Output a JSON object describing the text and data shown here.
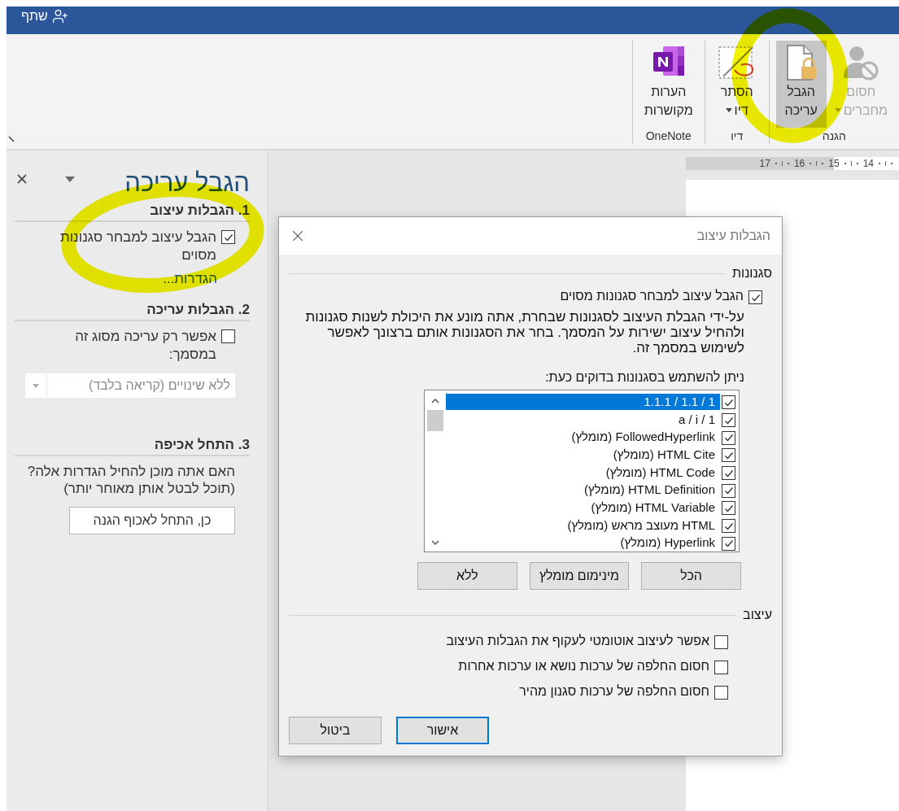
{
  "title_bar": {
    "share": "שתף"
  },
  "ribbon": {
    "groups": [
      {
        "label": "הגנה",
        "buttons": [
          {
            "kind": "block-authors",
            "lines": [
              "חסום",
              "מחברים"
            ],
            "dropdown": true,
            "disabled": true,
            "selected": false
          },
          {
            "kind": "restrict-editing",
            "lines": [
              "הגבל",
              "עריכה"
            ],
            "dropdown": false,
            "disabled": false,
            "selected": true
          }
        ]
      },
      {
        "label": "דיו",
        "buttons": [
          {
            "kind": "hide-ink",
            "lines": [
              "הסתר",
              "דיו"
            ],
            "dropdown": true,
            "disabled": false,
            "selected": false
          }
        ]
      },
      {
        "label": "OneNote",
        "buttons": [
          {
            "kind": "onenote",
            "lines": [
              "הערות",
              "מקושרות"
            ],
            "dropdown": false,
            "disabled": false,
            "selected": false
          }
        ]
      }
    ]
  },
  "ruler": {
    "labels": [
      "14",
      "15",
      "16",
      "17"
    ]
  },
  "pane": {
    "title": "הגבל עריכה",
    "sections": [
      {
        "heading": "1. הגבלות עיצוב",
        "items": [
          {
            "kind": "checkbox",
            "label": "הגבל עיצוב למבחר סגנונות מסוים",
            "checked": true
          },
          {
            "kind": "link",
            "label": "הגדרות..."
          }
        ]
      },
      {
        "heading": "2. הגבלות עריכה",
        "items": [
          {
            "kind": "checkbox",
            "label": "אפשר רק עריכה מסוג זה במסמך:",
            "checked": false
          },
          {
            "kind": "dropdown",
            "value": "ללא שינויים (קריאה בלבד)",
            "disabled": true
          }
        ]
      },
      {
        "heading": "3. התחל אכיפה",
        "items": [
          {
            "kind": "text",
            "text": "האם אתה מוכן להחיל הגדרות אלה? (תוכל לבטל אותן מאוחר יותר)"
          },
          {
            "kind": "button",
            "label": "כן, התחל לאכוף הגנה"
          }
        ]
      }
    ]
  },
  "dialog": {
    "title": "הגבלות עיצוב",
    "styles": {
      "heading": "סגנונות",
      "limit": {
        "label": "הגבל עיצוב למבחר סגנונות מסוים",
        "checked": true
      },
      "description": "על-ידי הגבלת העיצוב לסגנונות שבחרת, אתה מונע את היכולת לשנות סגנונות ולהחיל עיצוב ישירות על המסמך. בחר את הסגנונות אותם ברצונך לאפשר לשימוש במסמך זה.",
      "list_label": "ניתן להשתמש בסגנונות בדוקים כעת:",
      "list": [
        {
          "label": "1 / 1.1 / 1.1.1",
          "checked": true,
          "selected": true
        },
        {
          "label": "1 / a / i",
          "checked": true,
          "selected": false
        },
        {
          "label": "FollowedHyperlink (מומלץ)",
          "checked": true,
          "selected": false
        },
        {
          "label": "HTML Cite (מומלץ)",
          "checked": true,
          "selected": false
        },
        {
          "label": "HTML Code (מומלץ)",
          "checked": true,
          "selected": false
        },
        {
          "label": "HTML Definition (מומלץ)",
          "checked": true,
          "selected": false
        },
        {
          "label": "HTML Variable (מומלץ)",
          "checked": true,
          "selected": false
        },
        {
          "label": "HTML מעוצב מראש (מומלץ)",
          "checked": true,
          "selected": false
        },
        {
          "label": "Hyperlink (מומלץ)",
          "checked": true,
          "selected": false
        }
      ],
      "buttons": [
        "הכל",
        "מינימום מומלץ",
        "ללא"
      ]
    },
    "formatting": {
      "heading": "עיצוב",
      "options": [
        {
          "label": "אפשר לעיצוב אוטומטי לעקוף את הגבלות העיצוב",
          "checked": false
        },
        {
          "label": "חסום החלפה של ערכות נושא או ערכות אחרות",
          "checked": false
        },
        {
          "label": "חסום החלפה של ערכות סגנון מהיר",
          "checked": false
        }
      ]
    },
    "buttons": [
      {
        "label": "אישור",
        "default": true
      },
      {
        "label": "ביטול",
        "default": false
      }
    ]
  }
}
